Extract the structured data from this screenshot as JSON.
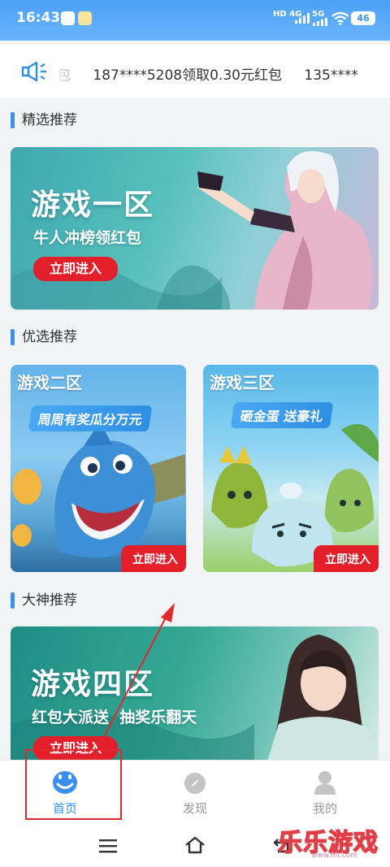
{
  "status_bar": {
    "time": "16:43",
    "network_1": "HD 4G",
    "network_2": "5G",
    "battery": "46"
  },
  "marquee": {
    "icon": "speaker-icon",
    "items": [
      "包",
      "187****5208领取0.30元红包",
      "135****"
    ]
  },
  "sections": {
    "featured": "精选推荐",
    "preferred": "优选推荐",
    "master": "大神推荐"
  },
  "banners": {
    "zone1": {
      "title": "游戏一区",
      "subtitle": "牛人冲榜领红包",
      "button": "立即进入"
    },
    "zone2": {
      "tag": "游戏二区",
      "slogan": "周周有奖瓜分万元",
      "button": "立即进入"
    },
    "zone3": {
      "tag": "游戏三区",
      "slogan": "砸金蛋 送豪礼",
      "button": "立即进入"
    },
    "zone4": {
      "title": "游戏四区",
      "subtitle": "红包大派送  抽奖乐翻天",
      "button": "立即进入"
    }
  },
  "tabbar": {
    "home": "首页",
    "discover": "发现",
    "mine": "我的"
  },
  "watermark": {
    "text": "乐乐游戏",
    "url": "www.6ll.com"
  },
  "colors": {
    "accent": "#2e8fe3",
    "red": "#e41f2c",
    "status_blue": "#4ba0f7"
  }
}
